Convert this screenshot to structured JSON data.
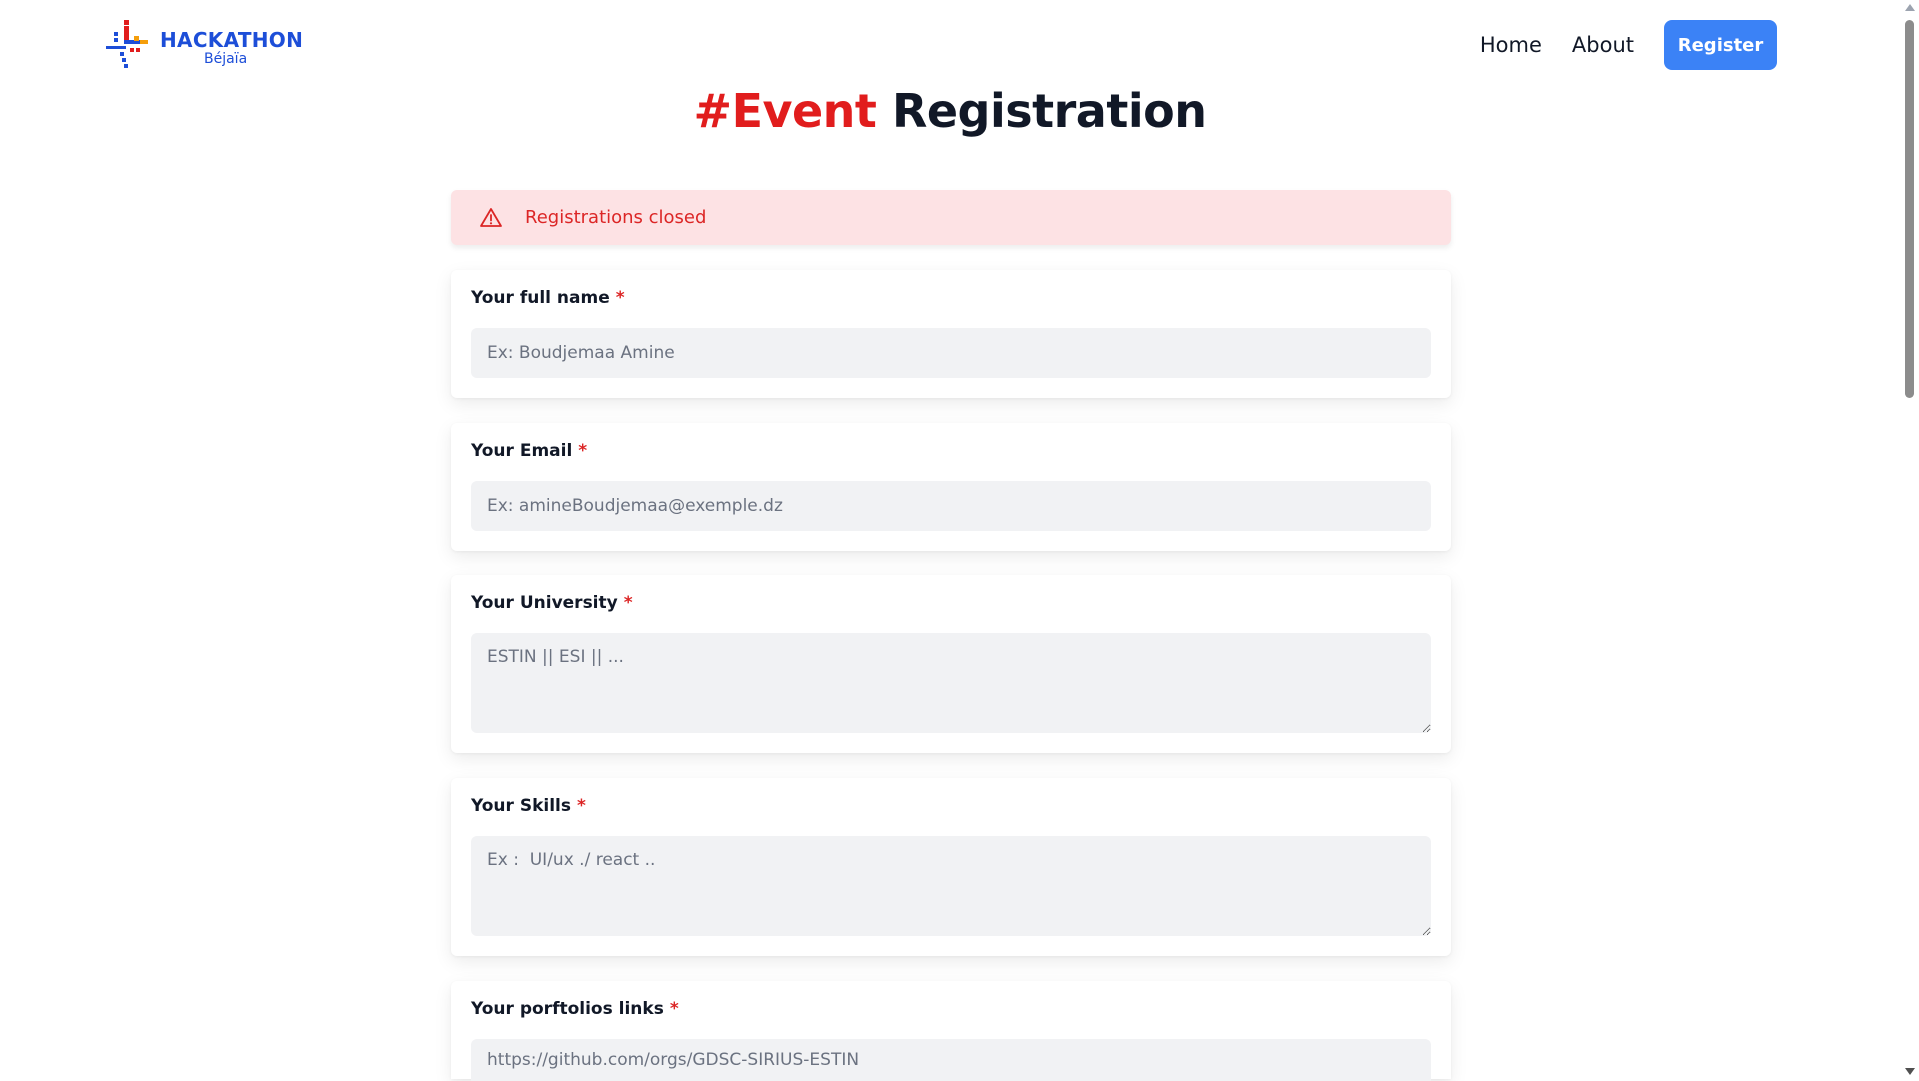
{
  "brand": {
    "title": "HACKATHON",
    "subtitle": "Béjaïa"
  },
  "nav": {
    "home": "Home",
    "about": "About",
    "register": "Register"
  },
  "page": {
    "title_accent": "#Event",
    "title_main": "Registration"
  },
  "alert": {
    "text": "Registrations closed",
    "icon": "warning-icon"
  },
  "form": {
    "fields": [
      {
        "label": "Your full name",
        "required_mark": "*",
        "placeholder": "Ex: Boudjemaa Amine"
      },
      {
        "label": "Your Email",
        "required_mark": "*",
        "placeholder": "Ex: amineBoudjemaa@exemple.dz"
      },
      {
        "label": "Your University",
        "required_mark": "*",
        "placeholder": "ESTIN || ESI || ..."
      },
      {
        "label": "Your Skills",
        "required_mark": "*",
        "placeholder": "Ex :  UI/ux ./ react .."
      },
      {
        "label": "Your porftolios links",
        "required_mark": "*",
        "placeholder": "https://github.com/orgs/GDSC-SIRIUS-ESTIN"
      }
    ]
  },
  "colors": {
    "accent": "#e11d1d",
    "button": "#3b82f6",
    "brand": "#1d4ed8",
    "alert_bg": "#fde2e4",
    "alert_text": "#dc2626"
  }
}
